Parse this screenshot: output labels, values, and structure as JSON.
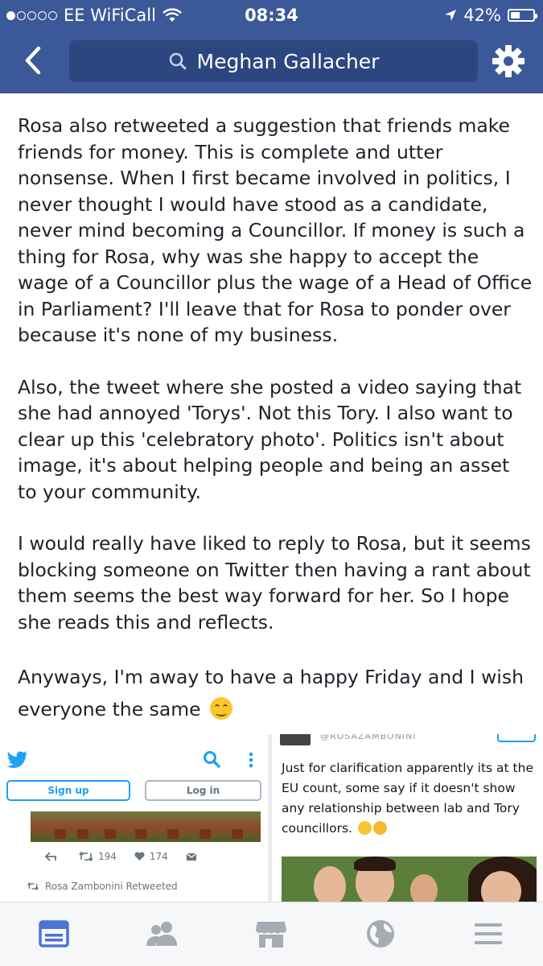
{
  "status_bar": {
    "carrier": "EE WiFiCall",
    "time": "08:34",
    "battery": "42%",
    "battery_level": 0.42
  },
  "nav": {
    "back_icon": "chevron-left-icon",
    "search_text": "Meghan Gallacher",
    "settings_icon": "gear-icon"
  },
  "post": {
    "paragraphs": [
      "Rosa also retweeted a suggestion that friends make friends for money. This is complete and utter nonsense. When I first became involved in politics, I never thought I would have stood as a candidate, never mind becoming a Councillor. If money is such a thing for Rosa, why was she happy to accept the wage of a Councillor plus the wage of a Head of Office in Parliament?  I'll leave that for Rosa to ponder over because it's none of my business.",
      "Also, the tweet where she posted a video saying that she had annoyed 'Torys'. Not this Tory. I also want to clear up this 'celebratory photo'. Politics isn't about image, it's about helping people and being an asset to your community.",
      "I would really have liked to reply to Rosa, but it seems blocking someone on Twitter then having a rant about them seems the best way forward for her. So I hope she reads this and reflects.",
      "Anyways, I'm away to have a happy Friday and I wish everyone the same"
    ],
    "closing_emoji": "smiling-face-emoji"
  },
  "tweet_left": {
    "signup": "Sign up",
    "login": "Log in",
    "retweets": "194",
    "likes": "174",
    "retweeted_by": "Rosa Zambonini Retweeted"
  },
  "tweet_right": {
    "handle": "@ROSAZAMBONINI",
    "text": "Just for clarification apparently its at the EU count, some say if it doesn't show any relationship between lab and Tory councillors."
  },
  "tabs": [
    {
      "name": "news-feed",
      "icon": "news-feed-icon",
      "active": true
    },
    {
      "name": "friends",
      "icon": "friends-icon",
      "active": false
    },
    {
      "name": "marketplace",
      "icon": "marketplace-icon",
      "active": false
    },
    {
      "name": "notifications",
      "icon": "globe-icon",
      "active": false
    },
    {
      "name": "menu",
      "icon": "menu-icon",
      "active": false
    }
  ],
  "colors": {
    "header": "#3b5998",
    "search_box": "#2c4680",
    "twitter_blue": "#1da1f2",
    "active_tab": "#4a76d1",
    "inactive_tab": "#a7abb3"
  }
}
